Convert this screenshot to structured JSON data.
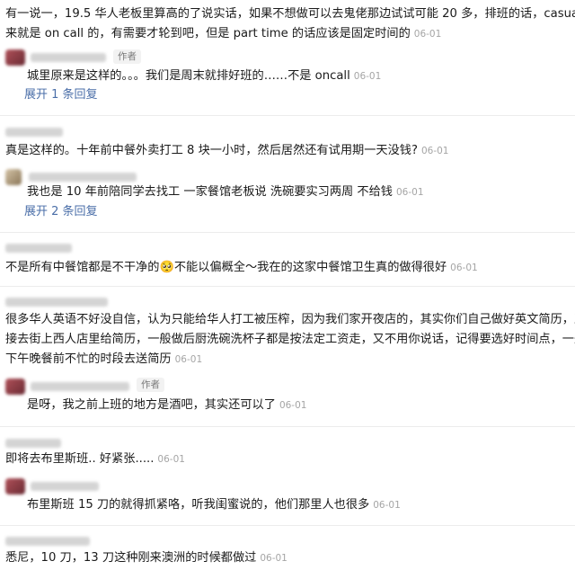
{
  "comments": [
    {
      "lines": [
        "有一说一，19.5 华人老板里算高的了说实话，如果不想做可以去鬼佬那边试试可能 20 多，排班的话，casual 本",
        "来就是 on call 的，有需要才轮到吧，但是 part time 的话应该是固定时间的"
      ],
      "date": "06-01",
      "replies": [
        {
          "author_tag": "作者",
          "text": "城里原来是这样的。。。我们是周末就排好班的……不是 oncall",
          "date": "06-01"
        }
      ],
      "expand_label": "展开 1 条回复"
    },
    {
      "lines": [
        "真是这样的。十年前中餐外卖打工 8 块一小时，然后居然还有试用期一天没钱?"
      ],
      "date": "06-01",
      "replies": [
        {
          "text": "我也是 10 年前陪同学去找工 一家餐馆老板说 洗碗要实习两周 不给钱",
          "date": "06-01"
        }
      ],
      "expand_label": "展开 2 条回复"
    },
    {
      "lines_parts": {
        "before": "不是所有中餐馆都是不干净的",
        "emoji": "🥺",
        "after": "不能以偏概全～我在的这家中餐馆卫生真的做得很好"
      },
      "date": "06-01"
    },
    {
      "lines": [
        "很多华人英语不好没自信，认为只能给华人打工被压榨，因为我们家开夜店的，其实你们自己做好英文简历，直",
        "接去街上西人店里给简历，一般做后厨洗碗洗杯子都是按法定工资走，又不用你说话，记得要选好时间点，一般",
        "下午晚餐前不忙的时段去送简历"
      ],
      "date": "06-01",
      "replies": [
        {
          "author_tag": "作者",
          "text": "是呀，我之前上班的地方是酒吧，其实还可以了",
          "date": "06-01"
        }
      ]
    },
    {
      "lines": [
        "即将去布里斯班.. 好紧张....."
      ],
      "date": "06-01",
      "replies": [
        {
          "text": "布里斯班 15 刀的就得抓紧咯，听我闺蜜说的，他们那里人也很多",
          "date": "06-01"
        }
      ]
    },
    {
      "lines": [
        "悉尼，10 刀，13 刀这种刚来澳洲的时候都做过"
      ],
      "date": "06-01"
    }
  ],
  "colors": {
    "link": "#4a6ea8",
    "date": "#a5a5a5",
    "divider": "#ececec"
  }
}
